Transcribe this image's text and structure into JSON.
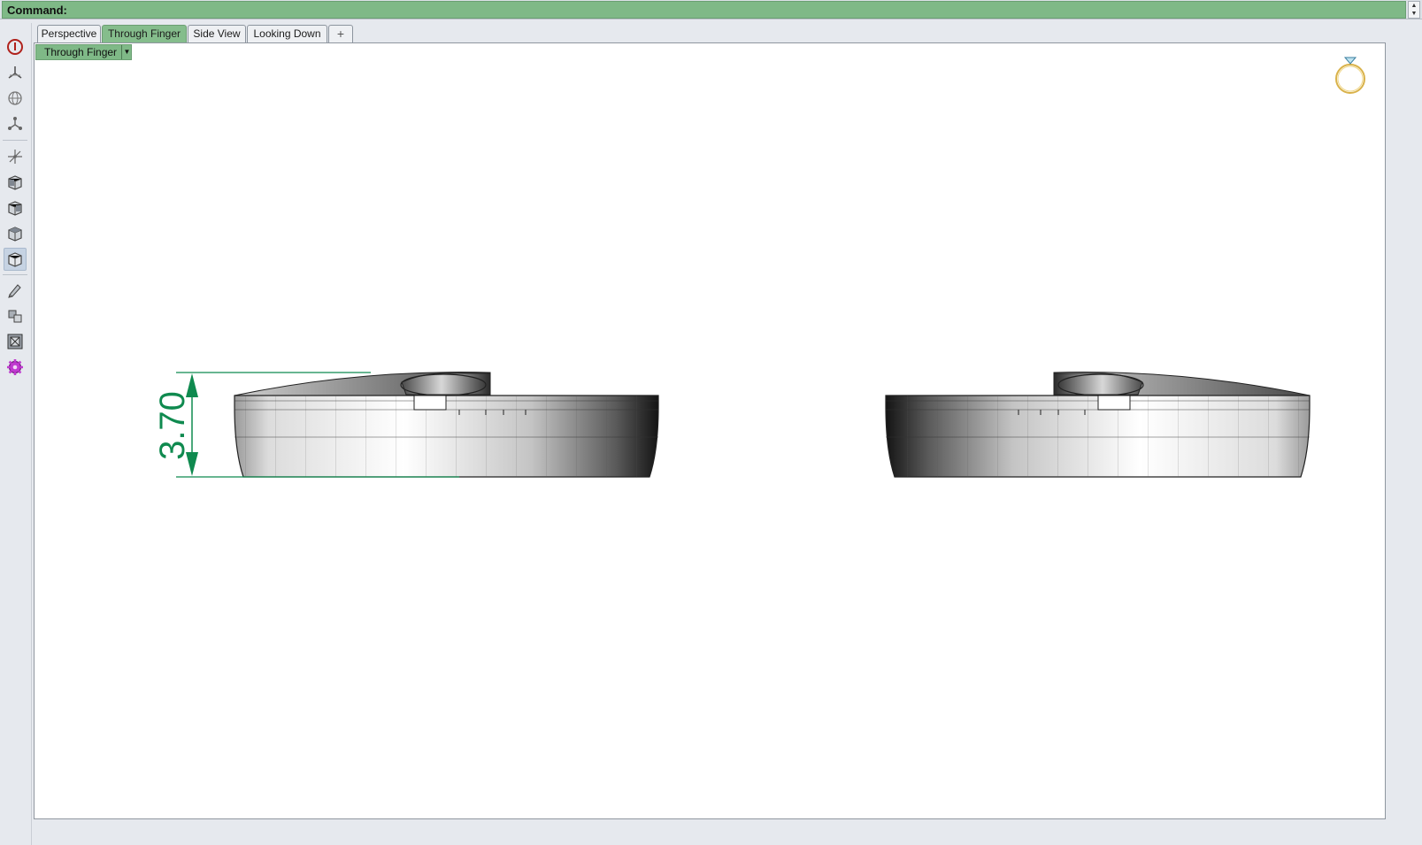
{
  "command_bar": {
    "label": "Command:"
  },
  "toolbar": {
    "tools": [
      {
        "name": "rhinogold-logo-icon"
      },
      {
        "name": "plane-icon"
      },
      {
        "name": "globe-icon"
      },
      {
        "name": "osnap-icon"
      },
      {
        "name": "gumball-axes-icon"
      },
      {
        "name": "box-view-icon-1"
      },
      {
        "name": "box-view-icon-2"
      },
      {
        "name": "box-view-icon-3"
      },
      {
        "name": "box-view-icon-4",
        "active": true
      },
      {
        "name": "pencil-icon"
      },
      {
        "name": "puzzle-icon"
      },
      {
        "name": "render-grid-icon"
      },
      {
        "name": "gear-magenta-icon"
      }
    ]
  },
  "tabs": [
    {
      "label": "Perspective",
      "active": false
    },
    {
      "label": "Through Finger",
      "active": true
    },
    {
      "label": "Side View",
      "active": false
    },
    {
      "label": "Looking Down",
      "active": false
    },
    {
      "label": "+",
      "active": false
    }
  ],
  "viewport": {
    "title": "Through Finger",
    "dimension_label": "3.70",
    "accent_color": "#0f8a4f",
    "tab_active_color": "#85bd8c",
    "corner_icon": "ring-icon"
  }
}
